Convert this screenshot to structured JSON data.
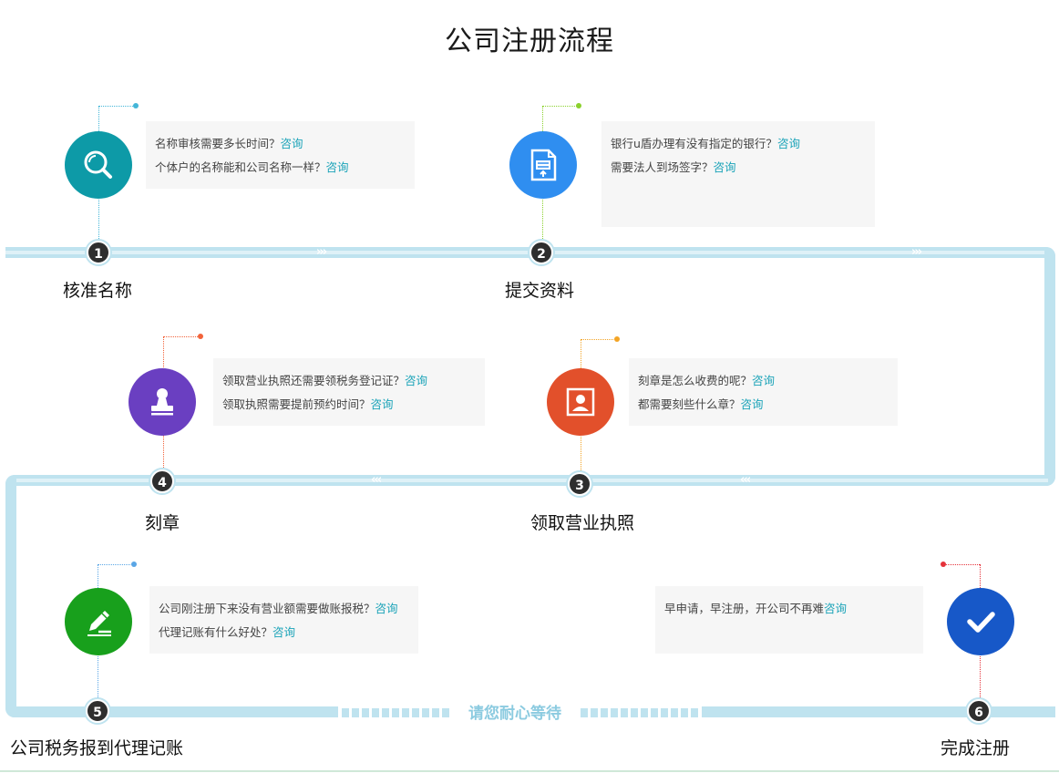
{
  "title": "公司注册流程",
  "wait_text": "请您耐心等待",
  "steps": [
    {
      "num": "1",
      "label": "核准名称",
      "color": "#0d9aa7",
      "icon": "search-icon",
      "accent": "#43b6d8",
      "faqs": [
        {
          "text": "名称审核需要多长时间？",
          "link": "咨询"
        },
        {
          "text": "个体户的名称能和公司名称一样？",
          "link": "咨询"
        }
      ]
    },
    {
      "num": "2",
      "label": "提交资料",
      "color": "#2f8ef0",
      "icon": "document-upload-icon",
      "accent": "#8bd12d",
      "faqs": [
        {
          "text": "银行u盾办理有没有指定的银行？",
          "link": "咨询"
        },
        {
          "text": "需要法人到场签字？",
          "link": "咨询"
        }
      ]
    },
    {
      "num": "3",
      "label": "领取营业执照",
      "color": "#e2502b",
      "icon": "id-card-icon",
      "accent": "#f3a425",
      "faqs": [
        {
          "text": "刻章是怎么收费的呢？",
          "link": "咨询"
        },
        {
          "text": "都需要刻些什么章？",
          "link": "咨询"
        }
      ]
    },
    {
      "num": "4",
      "label": "刻章",
      "color": "#6a3fc1",
      "icon": "stamp-icon",
      "accent": "#f2633a",
      "faqs": [
        {
          "text": "领取营业执照还需要领税务登记证？",
          "link": "咨询"
        },
        {
          "text": "领取执照需要提前预约时间？",
          "link": "咨询"
        }
      ]
    },
    {
      "num": "5",
      "label": "公司税务报到代理记账",
      "color": "#18a01c",
      "icon": "pen-icon",
      "accent": "#5aa6e6",
      "faqs": [
        {
          "text": "公司刚注册下来没有营业额需要做账报税？",
          "link": "咨询"
        },
        {
          "text": "代理记账有什么好处？",
          "link": "咨询"
        }
      ]
    },
    {
      "num": "6",
      "label": "完成注册",
      "color": "#1758c8",
      "icon": "checkmark-icon",
      "accent": "#e5323a",
      "faqs": [
        {
          "text": "早申请，早注册，开公司不再难",
          "link": "咨询"
        }
      ]
    }
  ]
}
